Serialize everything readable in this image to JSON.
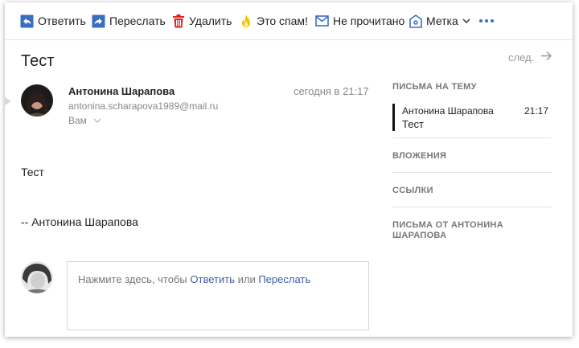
{
  "toolbar": {
    "reply": "Ответить",
    "forward": "Переслать",
    "delete": "Удалить",
    "spam": "Это спам!",
    "unread": "Не прочитано",
    "label": "Метка",
    "icons": {
      "reply": "reply-icon",
      "forward": "forward-icon",
      "delete": "trash-icon",
      "spam": "flame-icon",
      "unread": "envelope-icon",
      "label": "tag-icon",
      "more": "more-dots-icon"
    },
    "accent_color": "#3b6ec2",
    "delete_color": "#e0221b",
    "spam_color": "#f5c400"
  },
  "message": {
    "subject": "Тест",
    "next_label": "след.",
    "sender_name": "Антонина Шарапова",
    "sender_email": "antonina.scharapova1989@mail.ru",
    "recipient": "Вам",
    "time": "сегодня в 21:17",
    "body_line1": "Тест",
    "signature": "-- Антонина Шарапова"
  },
  "reply": {
    "prompt": "Нажмите здесь, чтобы",
    "reply_link": "Ответить",
    "or": "или",
    "forward_link": "Переслать"
  },
  "sidebar": {
    "thread_heading": "ПИСЬМА НА ТЕМУ",
    "thread_item": {
      "name": "Антонина Шарапова",
      "time": "21:17",
      "subject": "Тест"
    },
    "attachments_heading": "ВЛОЖЕНИЯ",
    "links_heading": "ССЫЛКИ",
    "from_sender_heading_line1": "ПИСЬМА ОТ АНТОНИНА",
    "from_sender_heading_line2": "ШАРАПОВА"
  }
}
